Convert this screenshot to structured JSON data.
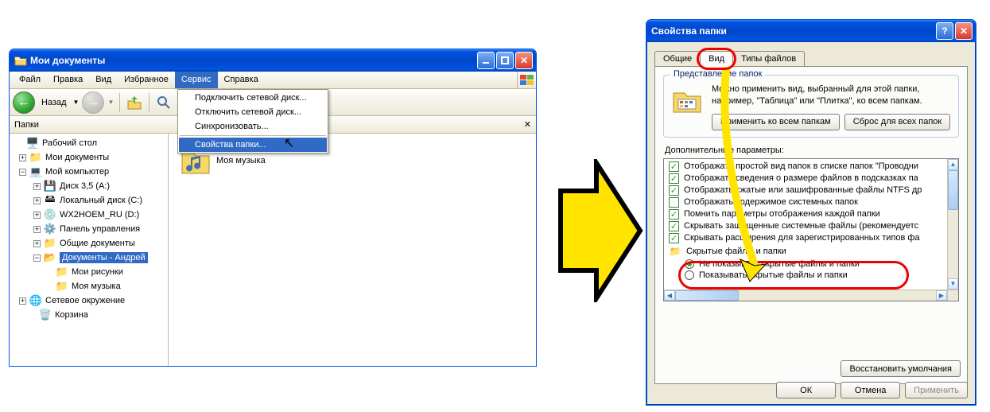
{
  "explorer": {
    "title": "Мои документы",
    "menu": {
      "file": "Файл",
      "edit": "Правка",
      "view": "Вид",
      "favorites": "Избранное",
      "tools": "Сервис",
      "help": "Справка"
    },
    "tools_menu": {
      "map_drive": "Подключить сетевой диск...",
      "disconnect_drive": "Отключить сетевой диск...",
      "sync": "Синхронизовать...",
      "folder_options": "Свойства папки..."
    },
    "nav": {
      "back": "Назад"
    },
    "pane_title": "Папки",
    "tree": {
      "desktop": "Рабочий стол",
      "my_docs": "Мои документы",
      "my_computer": "Мой компьютер",
      "floppy": "Диск 3,5 (A:)",
      "local_disk": "Локальный диск (C:)",
      "wx": "WX2HOEM_RU (D:)",
      "control_panel": "Панель управления",
      "shared_docs": "Общие документы",
      "user_docs": "Документы - Андрей",
      "my_pictures": "Мои рисунки",
      "my_music": "Моя музыка",
      "network": "Сетевое окружение",
      "recycle": "Корзина"
    },
    "content": {
      "my_music": "Моя музыка"
    }
  },
  "dialog": {
    "title": "Свойства папки",
    "tabs": {
      "general": "Общие",
      "view": "Вид",
      "file_types": "Типы файлов"
    },
    "group1": {
      "legend": "Представление папок",
      "text1": "Можно применить вид, выбранный для этой папки,",
      "text2": "например, \"Таблица\" или \"Плитка\", ко всем папкам.",
      "apply_all": "Применить ко всем папкам",
      "reset_all": "Сброс для всех папок"
    },
    "group2": {
      "legend": "Дополнительные параметры:",
      "opts": [
        {
          "type": "cb",
          "checked": true,
          "text": "Отображать простой вид папок в списке папок \"Проводни"
        },
        {
          "type": "cb",
          "checked": true,
          "text": "Отображать сведения о размере файлов в подсказках па"
        },
        {
          "type": "cb",
          "checked": true,
          "text": "Отображать сжатые или зашифрованные файлы NTFS др"
        },
        {
          "type": "cb",
          "checked": false,
          "text": "Отображать содержимое системных папок"
        },
        {
          "type": "cb",
          "checked": true,
          "text": "Помнить параметры отображения каждой папки"
        },
        {
          "type": "cb",
          "checked": true,
          "text": "Скрывать защищенные системные файлы (рекомендуетс"
        },
        {
          "type": "cb",
          "checked": true,
          "text": "Скрывать расширения для зарегистрированных типов фа"
        },
        {
          "type": "hdr",
          "text": "Скрытые файлы и папки"
        },
        {
          "type": "rb",
          "checked": true,
          "text": "Не показывать скрытые файлы и папки"
        },
        {
          "type": "rb",
          "checked": false,
          "text": "Показывать скрытые файлы и папки"
        }
      ],
      "restore": "Восстановить умолчания"
    },
    "buttons": {
      "ok": "ОК",
      "cancel": "Отмена",
      "apply": "Применить"
    }
  }
}
